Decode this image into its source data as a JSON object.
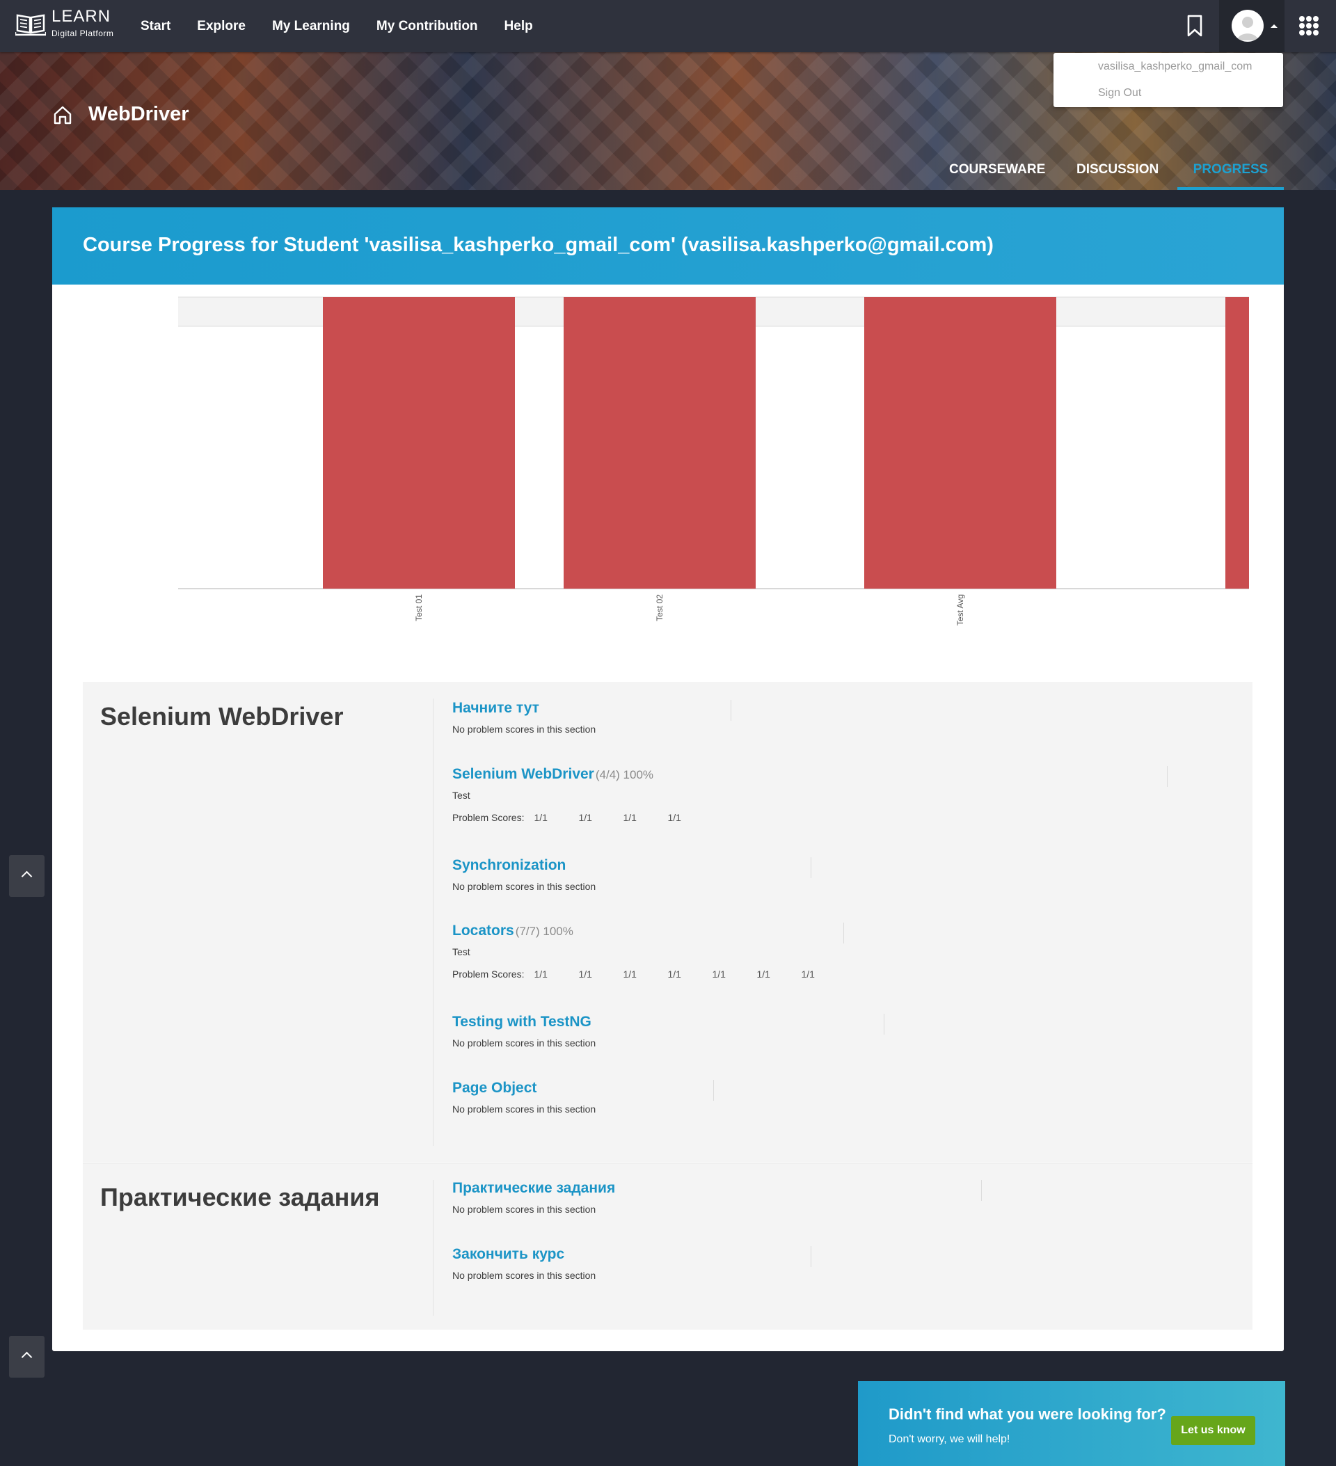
{
  "brand": {
    "title": "LEARN",
    "subtitle": "Digital Platform"
  },
  "nav": {
    "items": [
      "Start",
      "Explore",
      "My Learning",
      "My Contribution",
      "Help"
    ]
  },
  "user_menu": {
    "username": "vasilisa_kashperko_gmail_com",
    "sign_out": "Sign Out"
  },
  "course": {
    "title": "WebDriver",
    "tabs": [
      "COURSEWARE",
      "DISCUSSION",
      "PROGRESS"
    ],
    "active_tab": "PROGRESS"
  },
  "progress": {
    "header": "Course Progress for Student 'vasilisa_kashperko_gmail_com' (vasilisa.kashperko@gmail.com)"
  },
  "chart_data": {
    "type": "bar",
    "categories": [
      "Test 01",
      "Test 02",
      "Test Avg"
    ],
    "values": [
      1,
      1,
      1
    ],
    "ylim": [
      0,
      1
    ],
    "title": "",
    "xlabel": "",
    "ylabel": "",
    "bar_color": "#c94d4f",
    "grid": true
  },
  "chapters": [
    {
      "title": "Selenium WebDriver",
      "sections": [
        {
          "name": "Начните тут",
          "score": "",
          "note": "No problem scores in this section"
        },
        {
          "name": "Selenium WebDriver",
          "score": "(4/4) 100%",
          "test": "Test",
          "scores_label": "Problem Scores:",
          "scores": [
            "1/1",
            "1/1",
            "1/1",
            "1/1"
          ]
        },
        {
          "name": "Synchronization",
          "score": "",
          "note": "No problem scores in this section"
        },
        {
          "name": "Locators",
          "score": "(7/7) 100%",
          "test": "Test",
          "scores_label": "Problem Scores:",
          "scores": [
            "1/1",
            "1/1",
            "1/1",
            "1/1",
            "1/1",
            "1/1",
            "1/1"
          ]
        },
        {
          "name": "Testing with TestNG",
          "score": "",
          "note": "No problem scores in this section"
        },
        {
          "name": "Page Object",
          "score": "",
          "note": "No problem scores in this section"
        }
      ]
    },
    {
      "title": "Практические задания",
      "sections": [
        {
          "name": "Практические задания",
          "score": "",
          "note": "No problem scores in this section"
        },
        {
          "name": "Закончить курс",
          "score": "",
          "note": "No problem scores in this section"
        }
      ]
    }
  ],
  "help": {
    "title": "Didn't find what you were looking for?",
    "subtitle": "Don't worry, we will help!",
    "button": "Let us know"
  },
  "colors": {
    "accent": "#1b94c6",
    "header_bg": "#2f323d",
    "page_bg": "#222632",
    "help_button": "#66a61a"
  }
}
